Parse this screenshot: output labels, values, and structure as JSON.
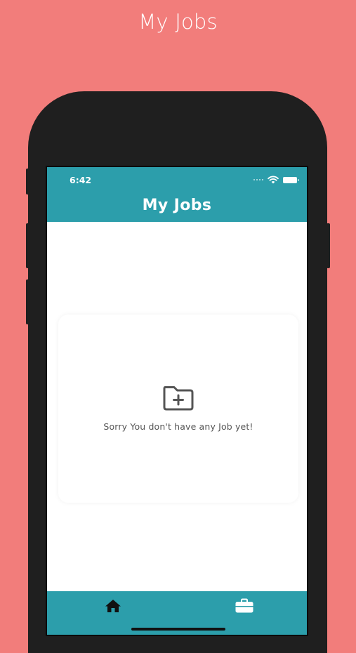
{
  "promo": {
    "title": "My Jobs"
  },
  "status_bar": {
    "time": "6:42",
    "icons": [
      "cellular-signal-icon",
      "wifi-icon",
      "battery-icon"
    ]
  },
  "header": {
    "title": "My Jobs"
  },
  "empty_state": {
    "icon": "folder-plus-icon",
    "message": "Sorry You don't have any Job yet!"
  },
  "bottom_nav": {
    "items": [
      {
        "icon": "home-icon",
        "active": true
      },
      {
        "icon": "briefcase-icon",
        "active": false
      }
    ]
  },
  "colors": {
    "background": "#f27d7b",
    "brand": "#2c9eab",
    "frame": "#1f1f1f",
    "text_muted": "#555555"
  }
}
